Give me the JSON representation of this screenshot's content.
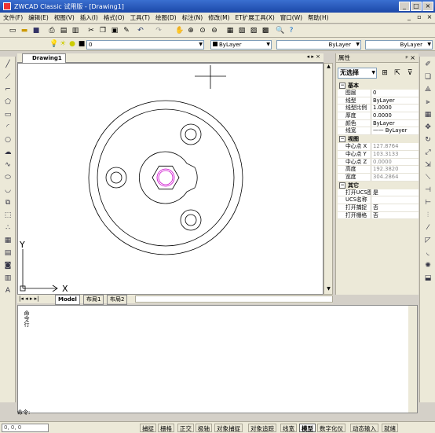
{
  "window": {
    "title": "ZWCAD Classic 试用版 - [Drawing1]"
  },
  "menu": [
    "文件(F)",
    "编辑(E)",
    "视图(V)",
    "插入(I)",
    "格式(O)",
    "工具(T)",
    "绘图(D)",
    "标注(N)",
    "修改(M)",
    "ET扩展工具(X)",
    "窗口(W)",
    "帮助(H)"
  ],
  "toolbar": {
    "layer_combo": "0",
    "color_combo": "ByLayer",
    "linetype_combo": "ByLayer",
    "lineweight_combo": "ByLayer"
  },
  "document": {
    "tab": "Drawing1"
  },
  "canvas": {
    "ucs_x_label": "X",
    "ucs_y_label": "Y"
  },
  "layout_tabs": [
    "Model",
    "布局1",
    "布局2"
  ],
  "properties": {
    "title": "属性",
    "selection": "无选择",
    "sections": [
      {
        "name": "基本",
        "rows": [
          {
            "k": "图层",
            "v": "0"
          },
          {
            "k": "线型",
            "v": "ByLayer"
          },
          {
            "k": "线型比例",
            "v": "1.0000"
          },
          {
            "k": "厚度",
            "v": "0.0000"
          },
          {
            "k": "颜色",
            "v": "ByLayer"
          },
          {
            "k": "线宽",
            "v": "—— ByLayer"
          }
        ]
      },
      {
        "name": "视图",
        "rows": [
          {
            "k": "中心点 X",
            "v": "127.8764"
          },
          {
            "k": "中心点 Y",
            "v": "103.3133"
          },
          {
            "k": "中心点 Z",
            "v": "0.0000"
          },
          {
            "k": "高度",
            "v": "192.3820"
          },
          {
            "k": "宽度",
            "v": "304.2864"
          }
        ]
      },
      {
        "name": "其它",
        "rows": [
          {
            "k": "打开UCS图标",
            "v": "是"
          },
          {
            "k": "UCS名称",
            "v": ""
          },
          {
            "k": "打开捕捉",
            "v": "否"
          },
          {
            "k": "打开栅格",
            "v": "否"
          }
        ]
      }
    ]
  },
  "command": {
    "side_label": "命令行",
    "prompt": "命令:"
  },
  "status": {
    "coords": "0, 0, 0",
    "buttons": [
      {
        "label": "捕捉",
        "on": false
      },
      {
        "label": "栅格",
        "on": false
      },
      {
        "label": "正交",
        "on": false
      },
      {
        "label": "极轴",
        "on": false
      },
      {
        "label": "对象捕捉",
        "on": false
      },
      {
        "label": "对象追踪",
        "on": false
      },
      {
        "label": "线宽",
        "on": false
      },
      {
        "label": "模型",
        "on": true
      },
      {
        "label": "数字化仪",
        "on": false
      },
      {
        "label": "动态输入",
        "on": false
      },
      {
        "label": "就绪",
        "on": false
      }
    ]
  }
}
